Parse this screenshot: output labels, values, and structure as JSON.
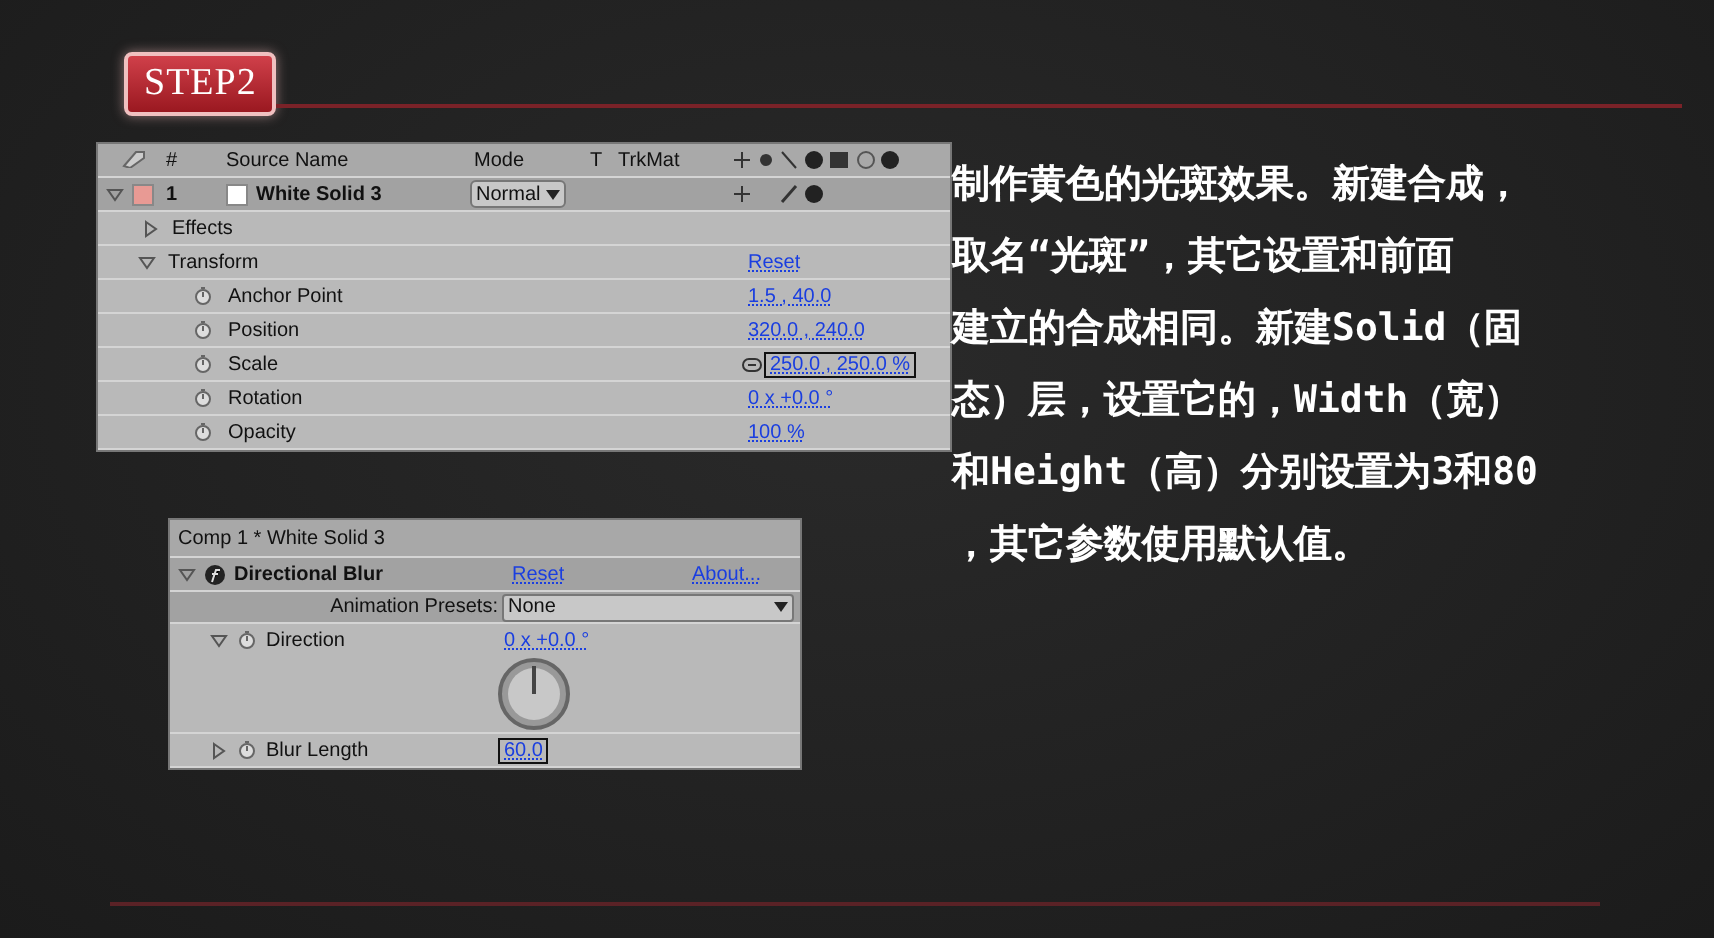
{
  "step_badge": "STEP2",
  "layer_panel": {
    "columns": [
      "#",
      "Source Name",
      "Mode",
      "T",
      "TrkMat"
    ],
    "layer": {
      "number": "1",
      "name": "White Solid 3",
      "mode": "Normal",
      "color": "#e89a94",
      "expanded": true
    },
    "properties": [
      {
        "kind": "group",
        "label": "Effects",
        "expanded": false
      },
      {
        "kind": "group",
        "label": "Transform",
        "expanded": true,
        "value": "Reset"
      },
      {
        "kind": "property",
        "label": "Anchor Point",
        "value": "1.5 , 40.0",
        "selected": false
      },
      {
        "kind": "property",
        "label": "Position",
        "value": "320.0 , 240.0",
        "selected": false
      },
      {
        "kind": "property",
        "label": "Scale",
        "value": "250.0 , 250.0 %",
        "selected": true,
        "linked": true
      },
      {
        "kind": "property",
        "label": "Rotation",
        "value": "0 x +0.0 °",
        "selected": false
      },
      {
        "kind": "property",
        "label": "Opacity",
        "value": "100 %",
        "selected": false
      }
    ]
  },
  "effect_panel": {
    "title": "Comp 1 * White Solid 3",
    "effect": {
      "name": "Directional Blur",
      "expanded": true,
      "reset": "Reset",
      "about": "About..."
    },
    "presets": {
      "label": "Animation Presets:",
      "value": "None"
    },
    "params": [
      {
        "kind": "angle",
        "label": "Direction",
        "value": "0 x +0.0 °",
        "expanded": true,
        "selected": false
      },
      {
        "kind": "number",
        "label": "Blur Length",
        "value": "60.0",
        "expanded": false,
        "selected": true
      }
    ]
  },
  "description_lines": [
    "制作黄色的光斑效果。新建合成，",
    "取名“光斑”，其它设置和前面",
    "建立的合成相同。新建Solid（固",
    "态）层，设置它的，Width（宽）",
    "和Height（高）分别设置为3和80",
    "，其它参数使用默认值。"
  ]
}
